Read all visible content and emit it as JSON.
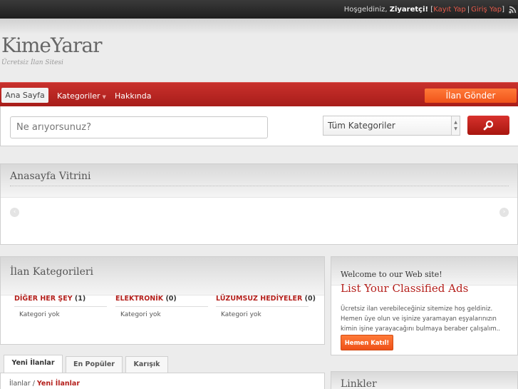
{
  "topbar": {
    "welcome": "Hoşgeldiniz,",
    "visitor": "Ziyaretçi!",
    "bracket_open": "[",
    "register": "Kayıt Yap",
    "separator": "|",
    "login": "Giriş Yap",
    "bracket_close": "]",
    "icon": "rss-icon"
  },
  "header": {
    "logo": "KimeYarar",
    "tagline": "Ücretsiz İlan Sitesi"
  },
  "nav": {
    "items": [
      {
        "label": "Ana Sayfa",
        "active": true
      },
      {
        "label": "Kategoriler",
        "dropdown": true
      },
      {
        "label": "Hakkında"
      }
    ],
    "post_button": "İlan Gönder"
  },
  "search": {
    "placeholder": "Ne arıyorsunuz?",
    "category_selected": "Tüm Kategoriler",
    "button_icon": "search-icon"
  },
  "showcase": {
    "title": "Anasayfa Vitrini"
  },
  "categories": {
    "title": "İlan Kategorileri",
    "items": [
      {
        "name": "DİĞER HER ŞEY",
        "count": "(1)",
        "sub": "Kategori yok"
      },
      {
        "name": "ELEKTRONİK",
        "count": "(0)",
        "sub": "Kategori yok"
      },
      {
        "name": "LÜZUMSUZ HEDİYELER",
        "count": "(0)",
        "sub": "Kategori yok"
      }
    ]
  },
  "welcome": {
    "small": "Welcome to our Web site!",
    "big": "List Your Classified Ads",
    "text": "Ücretsiz ilan verebileceğiniz sitemize hoş geldiniz. Hemen üye olun ve işinize yaramayan eşyalarınızın kimin işine yarayacağını bulmaya beraber çalışalım..",
    "button": "Hemen Katıl!"
  },
  "tabs": {
    "items": [
      "Yeni İlanlar",
      "En Popüler",
      "Karışık"
    ],
    "active": 0
  },
  "breadcrumb": {
    "root": "İlanlar",
    "separator": "/",
    "current": "Yeni İlanlar"
  },
  "links": {
    "title": "Linkler"
  },
  "colors": {
    "brand_red": "#b41f1b",
    "accent_orange": "#f0531a"
  }
}
